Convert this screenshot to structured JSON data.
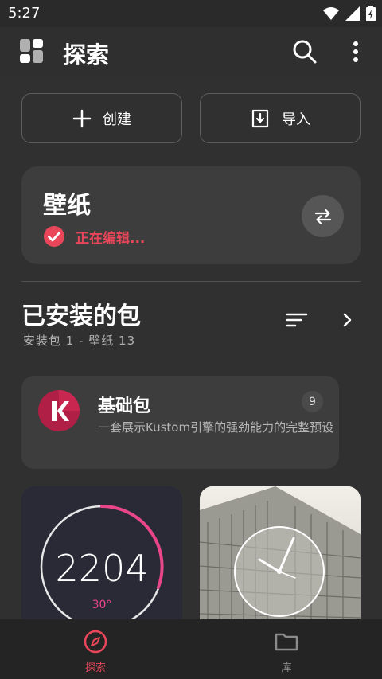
{
  "status_bar": {
    "time": "5:27",
    "icons": [
      "wifi-icon",
      "signal-icon",
      "battery-charging-icon"
    ]
  },
  "app_bar": {
    "title": "探索",
    "icons": [
      "app-logo-icon",
      "search-icon",
      "more-vert-icon"
    ]
  },
  "actions": {
    "create_label": "创建",
    "import_label": "导入"
  },
  "wallpaper": {
    "title": "壁纸",
    "status": "正在编辑..."
  },
  "installed": {
    "title": "已安装的包",
    "subtitle": "安装包 1 - 壁纸 13"
  },
  "package": {
    "name": "基础包",
    "description": "一套展示Kustom引擎的强劲能力的完整预设",
    "count": "9"
  },
  "previews": [
    {
      "time": "2204",
      "temperature": "30°",
      "progress": 0.4
    },
    {
      "kind": "analog-clock-on-building-photo"
    }
  ],
  "bottom_nav": {
    "explore_label": "探索",
    "library_label": "库"
  },
  "colors": {
    "background": "#303030",
    "card": "#3d3d3d",
    "accent": "#e9465a",
    "text_secondary": "#b0b0b0"
  }
}
